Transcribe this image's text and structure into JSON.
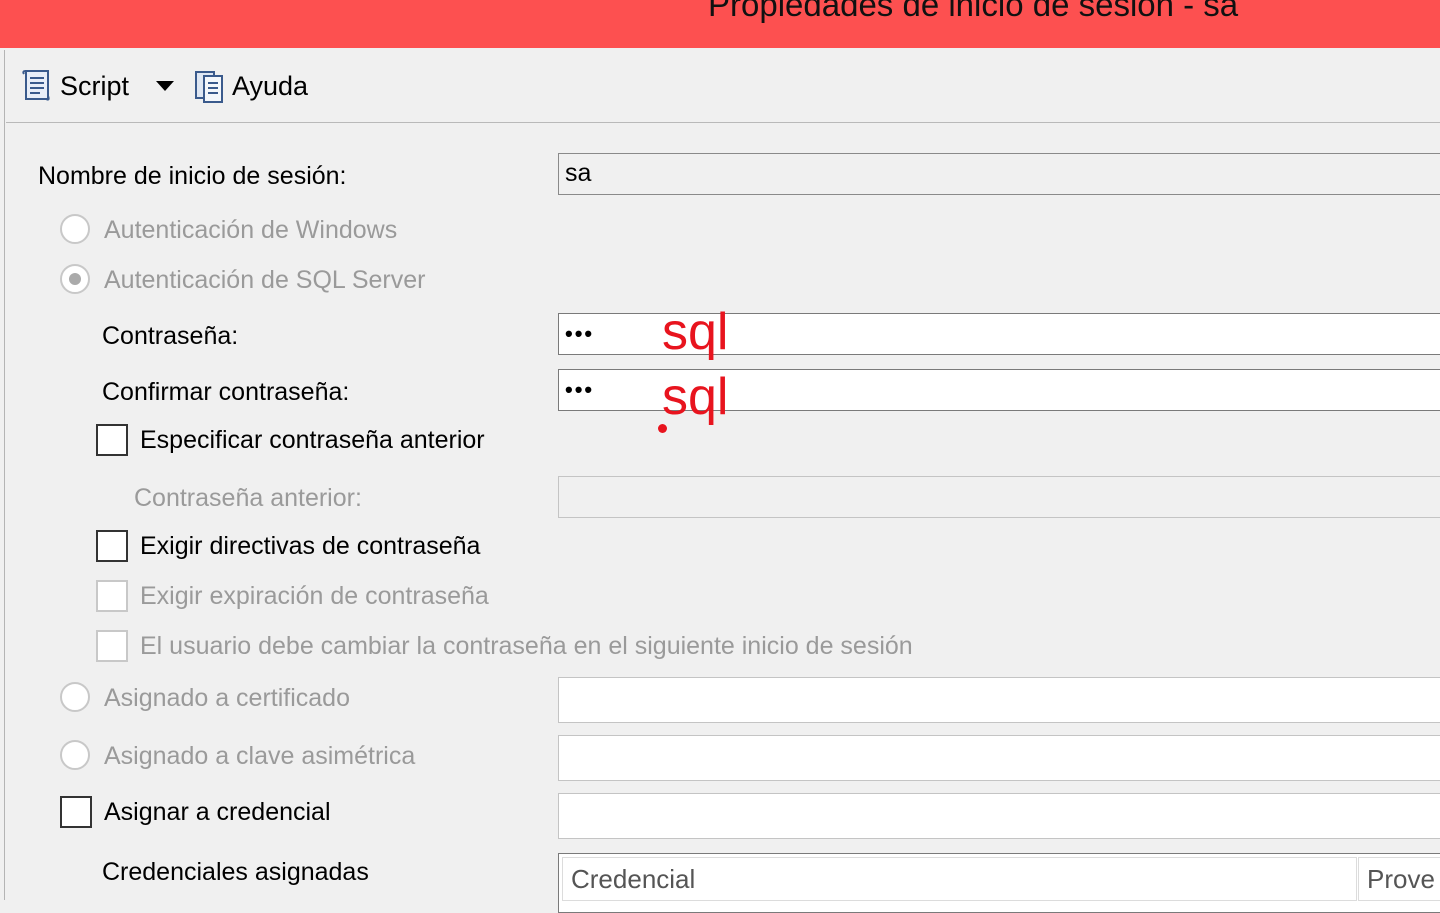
{
  "window": {
    "title": "Propiedades de inicio de sesión - sa"
  },
  "toolbar": {
    "script_label": "Script",
    "help_label": "Ayuda"
  },
  "form": {
    "login_name_label": "Nombre de inicio de sesión:",
    "login_name_value": "sa",
    "auth_windows_label": "Autenticación de Windows",
    "auth_sql_label": "Autenticación de SQL Server",
    "password_label": "Contraseña:",
    "password_value": "•••",
    "confirm_password_label": "Confirmar contraseña:",
    "confirm_password_value": "•••",
    "specify_old_password_label": "Especificar contraseña anterior",
    "old_password_label": "Contraseña anterior:",
    "enforce_policy_label": "Exigir directivas de contraseña",
    "enforce_expiration_label": "Exigir expiración de contraseña",
    "must_change_label": "El usuario debe cambiar la contraseña en el siguiente inicio de sesión",
    "mapped_certificate_label": "Asignado a certificado",
    "mapped_asym_key_label": "Asignado a clave asimétrica",
    "map_credential_label": "Asignar a credencial",
    "mapped_credentials_label": "Credenciales asignadas",
    "grid_columns": [
      "Credencial",
      "Prove"
    ]
  },
  "annotations": {
    "password_hint": "sql",
    "confirm_hint": "sql",
    "color": "#e8141e"
  },
  "colors": {
    "titlebar": "#fd5050",
    "background": "#f0f0f0"
  }
}
